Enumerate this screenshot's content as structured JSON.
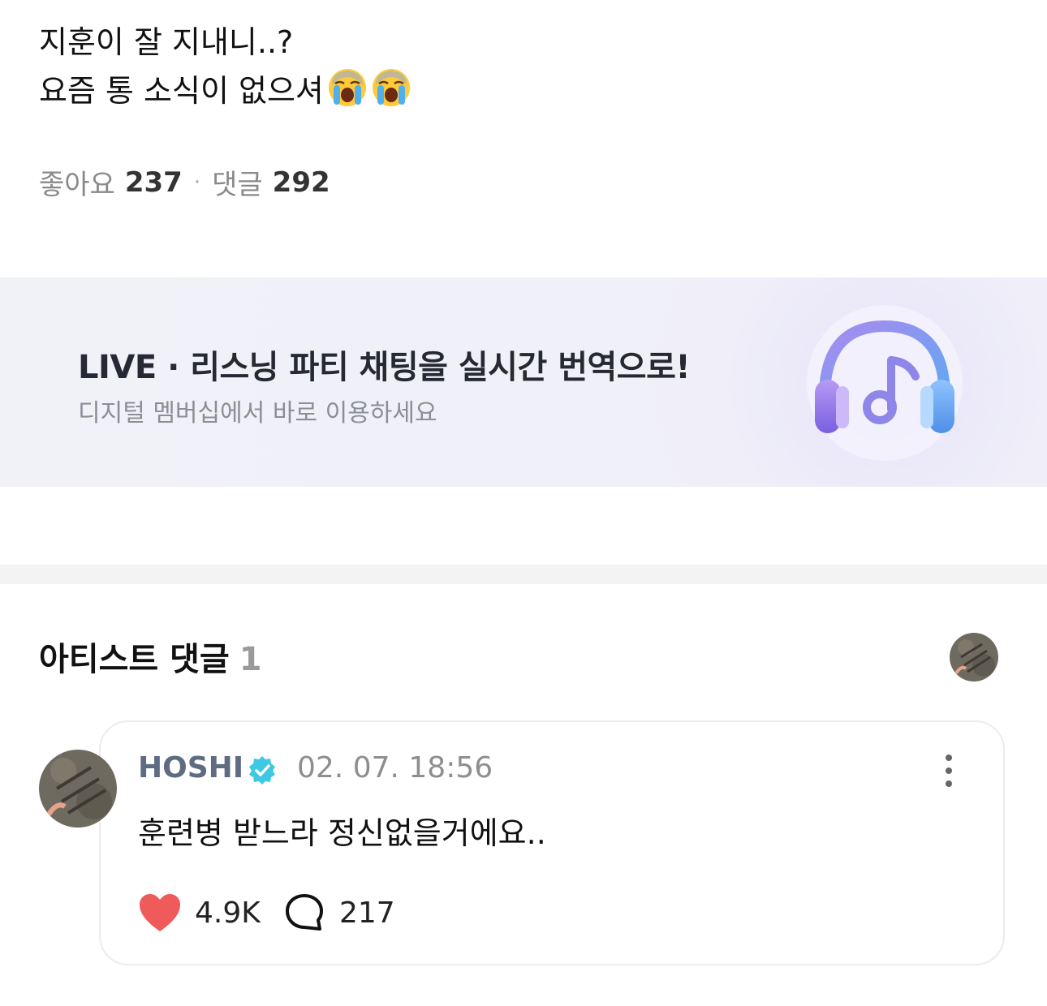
{
  "post": {
    "line1": "지훈이 잘 지내니..?",
    "line2": "요즘 통 소식이 없으셔",
    "emojis": [
      "loudly-crying-face",
      "loudly-crying-face"
    ]
  },
  "stats": {
    "likes_label": "좋아요",
    "likes_count": "237",
    "separator": "·",
    "comments_label": "댓글",
    "comments_count": "292"
  },
  "banner": {
    "title": "LIVE · 리스닝 파티 채팅을 실시간 번역으로!",
    "subtitle": "디지털 멤버십에서 바로 이용하세요",
    "icon": "headphones-music-icon"
  },
  "artist_comments": {
    "title": "아티스트 댓글",
    "count": "1"
  },
  "comment": {
    "author": "HOSHI",
    "verified": true,
    "timestamp": "02. 07. 18:56",
    "text": "훈련병 받느라 정신없을거에요..",
    "likes": "4.9K",
    "replies": "217",
    "like_color": "#ef5b5b"
  }
}
